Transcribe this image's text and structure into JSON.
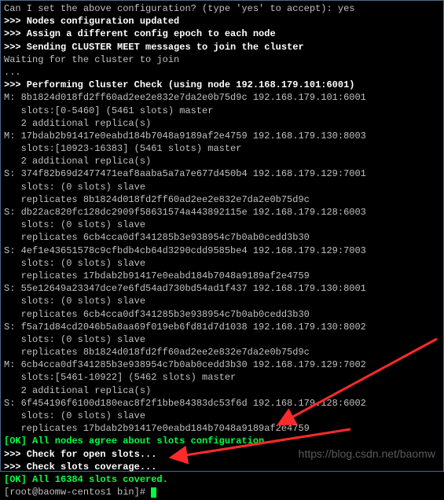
{
  "lines": [
    {
      "cls": "grey",
      "indent": 0,
      "text": "Can I set the above configuration? (type 'yes' to accept): yes"
    },
    {
      "cls": "white-bold",
      "indent": 0,
      "text": ">>> Nodes configuration updated"
    },
    {
      "cls": "white-bold",
      "indent": 0,
      "text": ">>> Assign a different config epoch to each node"
    },
    {
      "cls": "white-bold",
      "indent": 0,
      "text": ">>> Sending CLUSTER MEET messages to join the cluster"
    },
    {
      "cls": "grey",
      "indent": 0,
      "text": "Waiting for the cluster to join"
    },
    {
      "cls": "grey",
      "indent": 0,
      "text": "..."
    },
    {
      "cls": "white-bold",
      "indent": 0,
      "text": ">>> Performing Cluster Check (using node 192.168.179.101:6001)"
    },
    {
      "cls": "grey",
      "indent": 0,
      "text": "M: 8b1824d018fd2ff60ad2ee2e832e7da2e0b75d9c 192.168.179.101:6001"
    },
    {
      "cls": "grey",
      "indent": 1,
      "text": "slots:[0-5460] (5461 slots) master"
    },
    {
      "cls": "grey",
      "indent": 1,
      "text": "2 additional replica(s)"
    },
    {
      "cls": "grey",
      "indent": 0,
      "text": "M: 17bdab2b91417e0eabd184b7048a9189af2e4759 192.168.179.130:8003"
    },
    {
      "cls": "grey",
      "indent": 1,
      "text": "slots:[10923-16383] (5461 slots) master"
    },
    {
      "cls": "grey",
      "indent": 1,
      "text": "2 additional replica(s)"
    },
    {
      "cls": "grey",
      "indent": 0,
      "text": "S: 374f82b69d2477471eaf8aaba5a7a7e677d450b4 192.168.179.129:7001"
    },
    {
      "cls": "grey",
      "indent": 1,
      "text": "slots: (0 slots) slave"
    },
    {
      "cls": "grey",
      "indent": 1,
      "text": "replicates 8b1824d018fd2ff60ad2ee2e832e7da2e0b75d9c"
    },
    {
      "cls": "grey",
      "indent": 0,
      "text": "S: db22ac820fc128dc2909f58631574a443892115e 192.168.179.128:6003"
    },
    {
      "cls": "grey",
      "indent": 1,
      "text": "slots: (0 slots) slave"
    },
    {
      "cls": "grey",
      "indent": 1,
      "text": "replicates 6cb4cca0df341285b3e938954c7b0ab0cedd3b30"
    },
    {
      "cls": "grey",
      "indent": 0,
      "text": "S: 4ef1e43651578c9cfbdb4cb64d3290cdd9585be4 192.168.179.129:7003"
    },
    {
      "cls": "grey",
      "indent": 1,
      "text": "slots: (0 slots) slave"
    },
    {
      "cls": "grey",
      "indent": 1,
      "text": "replicates 17bdab2b91417e0eabd184b7048a9189af2e4759"
    },
    {
      "cls": "grey",
      "indent": 0,
      "text": "S: 55e12649a23347dce7e6fd54ad730bd54ad1f437 192.168.179.130:8001"
    },
    {
      "cls": "grey",
      "indent": 1,
      "text": "slots: (0 slots) slave"
    },
    {
      "cls": "grey",
      "indent": 1,
      "text": "replicates 6cb4cca0df341285b3e938954c7b0ab0cedd3b30"
    },
    {
      "cls": "grey",
      "indent": 0,
      "text": "S: f5a71d84cd2046b5a8aa69f019eb6fd81d7d1038 192.168.179.130:8002"
    },
    {
      "cls": "grey",
      "indent": 1,
      "text": "slots: (0 slots) slave"
    },
    {
      "cls": "grey",
      "indent": 1,
      "text": "replicates 8b1824d018fd2ff60ad2ee2e832e7da2e0b75d9c"
    },
    {
      "cls": "grey",
      "indent": 0,
      "text": "M: 6cb4cca0df341285b3e938954c7b0ab0cedd3b30 192.168.179.129:7002"
    },
    {
      "cls": "grey",
      "indent": 1,
      "text": "slots:[5461-10922] (5462 slots) master"
    },
    {
      "cls": "grey",
      "indent": 1,
      "text": "2 additional replica(s)"
    },
    {
      "cls": "grey",
      "indent": 0,
      "text": "S: 6f454196f6100d180eac8f2f1bbe84383dc53f6d 192.168.179.128:6002"
    },
    {
      "cls": "grey",
      "indent": 1,
      "text": "slots: (0 slots) slave"
    },
    {
      "cls": "grey",
      "indent": 1,
      "text": "replicates 17bdab2b91417e0eabd184b7048a9189af2e4759"
    },
    {
      "cls": "green-bold",
      "indent": 0,
      "text": "[OK] All nodes agree about slots configuration."
    },
    {
      "cls": "white-bold",
      "indent": 0,
      "text": ">>> Check for open slots..."
    },
    {
      "cls": "white-bold",
      "indent": 0,
      "text": ">>> Check slots coverage..."
    },
    {
      "cls": "green-bold",
      "indent": 0,
      "text": "[OK] All 16384 slots covered."
    }
  ],
  "prompt": "[root@baomw-centos1 bin]# ",
  "watermark": "https://blog.csdn.net/baomw"
}
